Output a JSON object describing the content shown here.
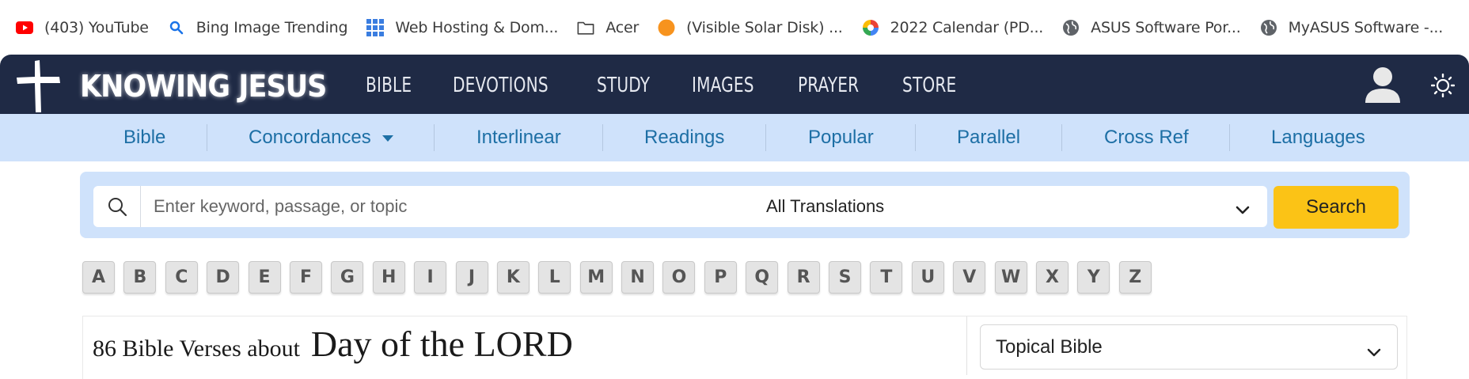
{
  "bookmarks": [
    {
      "label": "(403) YouTube",
      "icon": "youtube-icon"
    },
    {
      "label": "Bing Image Trending",
      "icon": "search-icon"
    },
    {
      "label": "Web Hosting & Dom...",
      "icon": "grid-icon"
    },
    {
      "label": "Acer",
      "icon": "folder-icon"
    },
    {
      "label": "(Visible Solar Disk) ...",
      "icon": "orange-circle-icon"
    },
    {
      "label": "2022 Calendar (PD...",
      "icon": "calendar-logo-icon"
    },
    {
      "label": "ASUS Software Por...",
      "icon": "globe-icon"
    },
    {
      "label": "MyASUS Software -...",
      "icon": "globe-icon"
    }
  ],
  "header": {
    "brand": "KNOWING JESUS",
    "nav": [
      "BIBLE",
      "DEVOTIONS",
      "STUDY",
      "IMAGES",
      "PRAYER",
      "STORE"
    ]
  },
  "subnav": {
    "items": [
      "Bible",
      "Concordances",
      "Interlinear",
      "Readings",
      "Popular",
      "Parallel",
      "Cross Ref",
      "Languages"
    ]
  },
  "search": {
    "placeholder": "Enter keyword, passage, or topic",
    "translation": "All Translations",
    "button": "Search"
  },
  "letters": [
    "A",
    "B",
    "C",
    "D",
    "E",
    "F",
    "G",
    "H",
    "I",
    "J",
    "K",
    "L",
    "M",
    "N",
    "O",
    "P",
    "Q",
    "R",
    "S",
    "T",
    "U",
    "V",
    "W",
    "X",
    "Y",
    "Z"
  ],
  "content": {
    "count_prefix": "86 Bible Verses about",
    "topic": "Day of the LORD",
    "topical_select": "Topical Bible"
  },
  "colors": {
    "nav_bg": "#1f2a45",
    "subnav_bg": "#cfe2fb",
    "link": "#1d6fa5",
    "search_button": "#fbc316"
  }
}
